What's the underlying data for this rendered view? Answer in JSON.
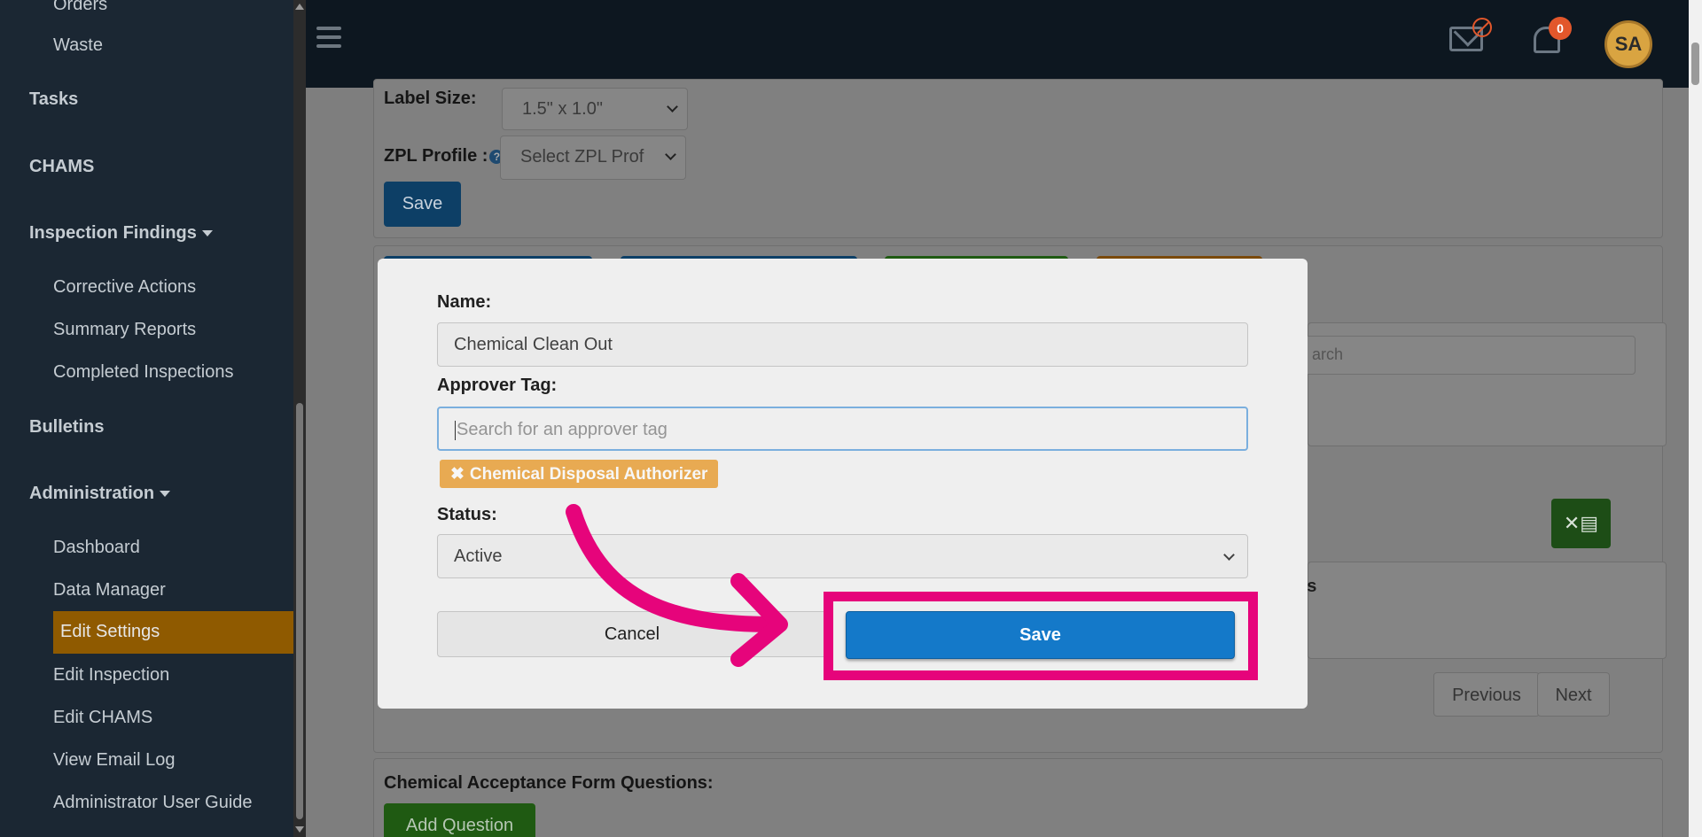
{
  "sidebar": {
    "items": [
      {
        "label": "Orders"
      },
      {
        "label": "Waste"
      },
      {
        "label": "Tasks"
      },
      {
        "label": "CHAMS"
      },
      {
        "label": "Inspection Findings"
      },
      {
        "label": "Corrective Actions"
      },
      {
        "label": "Summary Reports"
      },
      {
        "label": "Completed Inspections"
      },
      {
        "label": "Bulletins"
      },
      {
        "label": "Administration"
      },
      {
        "label": "Dashboard"
      },
      {
        "label": "Data Manager"
      },
      {
        "label": "Edit Settings"
      },
      {
        "label": "Edit Inspection"
      },
      {
        "label": "Edit CHAMS"
      },
      {
        "label": "View Email Log"
      },
      {
        "label": "Administrator User Guide"
      }
    ]
  },
  "header": {
    "notification_count": "0",
    "avatar_initials": "SA"
  },
  "background": {
    "label_size_label": "Label Size:",
    "label_size_value": "1.5\" x 1.0\"",
    "zpl_profile_label": "ZPL Profile :",
    "zpl_profile_value": "Select ZPL Prof",
    "save_label": "Save",
    "search_placeholder": "arch",
    "column_fragment": "us",
    "previous_label": "Previous",
    "next_label": "Next",
    "questions_title": "Chemical Acceptance Form Questions:",
    "add_question_label": "Add Question"
  },
  "modal": {
    "name_label": "Name:",
    "name_value": "Chemical Clean Out",
    "approver_label": "Approver Tag:",
    "approver_placeholder": "Search for an approver tag",
    "tag_label": "Chemical Disposal Authorizer",
    "status_label": "Status:",
    "status_value": "Active",
    "cancel_label": "Cancel",
    "save_label": "Save"
  },
  "colors": {
    "sidebar_bg": "#1b2733",
    "active_item": "#8f5a00",
    "primary_button": "#1479c9",
    "tag": "#f0b055",
    "highlight": "#e6047b"
  }
}
